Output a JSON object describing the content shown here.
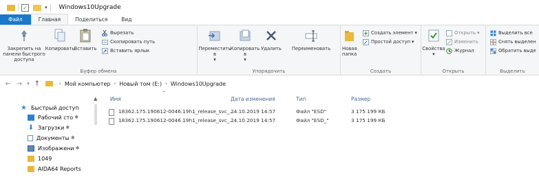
{
  "window": {
    "title": "Windows10Upgrade"
  },
  "ribbon_tabs": [
    "Файл",
    "Главная",
    "Поделиться",
    "Вид"
  ],
  "ribbon": {
    "clipboard": {
      "label": "Буфер обмена",
      "pin": "Закрепить на панели быстрого доступа",
      "copy": "Копировать",
      "paste": "Вставить",
      "cut": "Вырезать",
      "copy_path": "Скопировать путь",
      "paste_shortcut": "Вставить ярлык"
    },
    "organize": {
      "label": "Упорядочить",
      "move": "Переместить в",
      "copy_to": "Копировать в",
      "delete": "Удалить",
      "rename": "Переименовать"
    },
    "create": {
      "label": "Создать",
      "new_folder": "Новая папка",
      "new_item": "Создать элемент",
      "easy_access": "Простой доступ"
    },
    "open": {
      "label": "Открыть",
      "properties": "Свойства",
      "open": "Открыть",
      "edit": "Изменить",
      "history": "Журнал"
    },
    "select": {
      "label": "Выделить",
      "select_all": "Выделить все",
      "select_none": "Снять выделен",
      "invert": "Обратить выде"
    }
  },
  "address": {
    "crumbs": [
      "Мой компьютер",
      "Новый том (E:)",
      "Windows10Upgrade"
    ]
  },
  "nav_pane": {
    "items": [
      {
        "label": "Быстрый доступ",
        "icon": "star-icon",
        "pinned": false
      },
      {
        "label": "Рабочий сто",
        "icon": "desktop-icon",
        "pinned": true
      },
      {
        "label": "Загрузки",
        "icon": "download-icon",
        "pinned": true
      },
      {
        "label": "Документы",
        "icon": "documents-icon",
        "pinned": true
      },
      {
        "label": "Изображени",
        "icon": "pictures-icon",
        "pinned": true
      },
      {
        "label": "1049",
        "icon": "folder-icon",
        "pinned": false
      },
      {
        "label": "AIDA64 Reports",
        "icon": "folder-icon",
        "pinned": false
      }
    ]
  },
  "file_list": {
    "columns": [
      "Имя",
      "Дата изменения",
      "Тип",
      "Размер"
    ],
    "rows": [
      {
        "name": "18362.175.190612-0046.19h1_release_svc_...",
        "date": "24.10.2019 14:57",
        "type": "Файл \"ESD\"",
        "size": "3 175 199 КБ"
      },
      {
        "name": "18362.175.190612-0046.19h1_release_svc_...",
        "date": "24.10.2019 14:57",
        "type": "Файл \"ESD_\"",
        "size": "3 175 199 КБ"
      }
    ]
  },
  "colors": {
    "file_tab": "#1979ca",
    "folder": "#e8b93a",
    "ribbon_bg": "#f5f6f7",
    "column_header": "#4b6a94"
  }
}
